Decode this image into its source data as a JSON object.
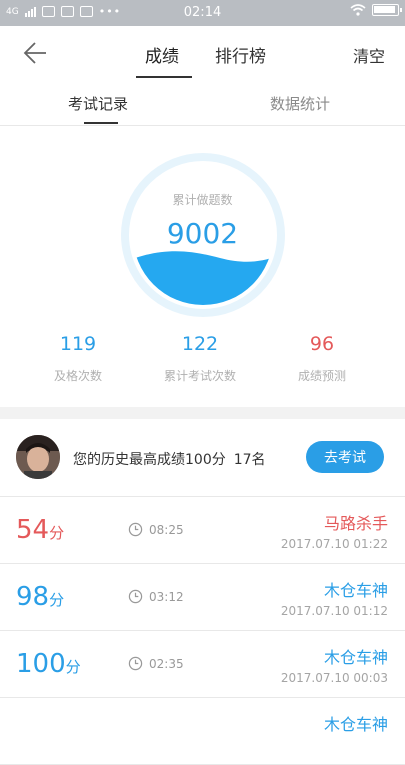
{
  "status_bar": {
    "network": "4G",
    "time": "02:14",
    "dots": "•••"
  },
  "header": {
    "tabs": [
      {
        "label": "成绩"
      },
      {
        "label": "排行榜"
      }
    ],
    "clear_label": "清空"
  },
  "subtabs": [
    {
      "label": "考试记录"
    },
    {
      "label": "数据统计"
    }
  ],
  "summary": {
    "total_label": "累计做题数",
    "total_value": "9002",
    "stats": [
      {
        "value": "119",
        "label": "及格次数",
        "color": "#2a9ee6"
      },
      {
        "value": "122",
        "label": "累计考试次数",
        "color": "#2a9ee6"
      },
      {
        "value": "96",
        "label": "成绩预测",
        "color": "#e4595a"
      }
    ]
  },
  "best": {
    "text": "您的历史最高成绩100分",
    "rank": "17名",
    "button_label": "去考试"
  },
  "records": [
    {
      "score": "54",
      "unit": "分",
      "duration": "08:25",
      "name": "马路杀手",
      "date": "2017.07.10  01:22",
      "color": "#e4595a"
    },
    {
      "score": "98",
      "unit": "分",
      "duration": "03:12",
      "name": "木仓车神",
      "date": "2017.07.10  01:12",
      "color": "#2a9ee6"
    },
    {
      "score": "100",
      "unit": "分",
      "duration": "02:35",
      "name": "木仓车神",
      "date": "2017.07.10  00:03",
      "color": "#2a9ee6"
    },
    {
      "name": "木仓车神",
      "color": "#2a9ee6"
    }
  ],
  "colors": {
    "accent": "#2a9ee6",
    "fail": "#e4595a"
  }
}
